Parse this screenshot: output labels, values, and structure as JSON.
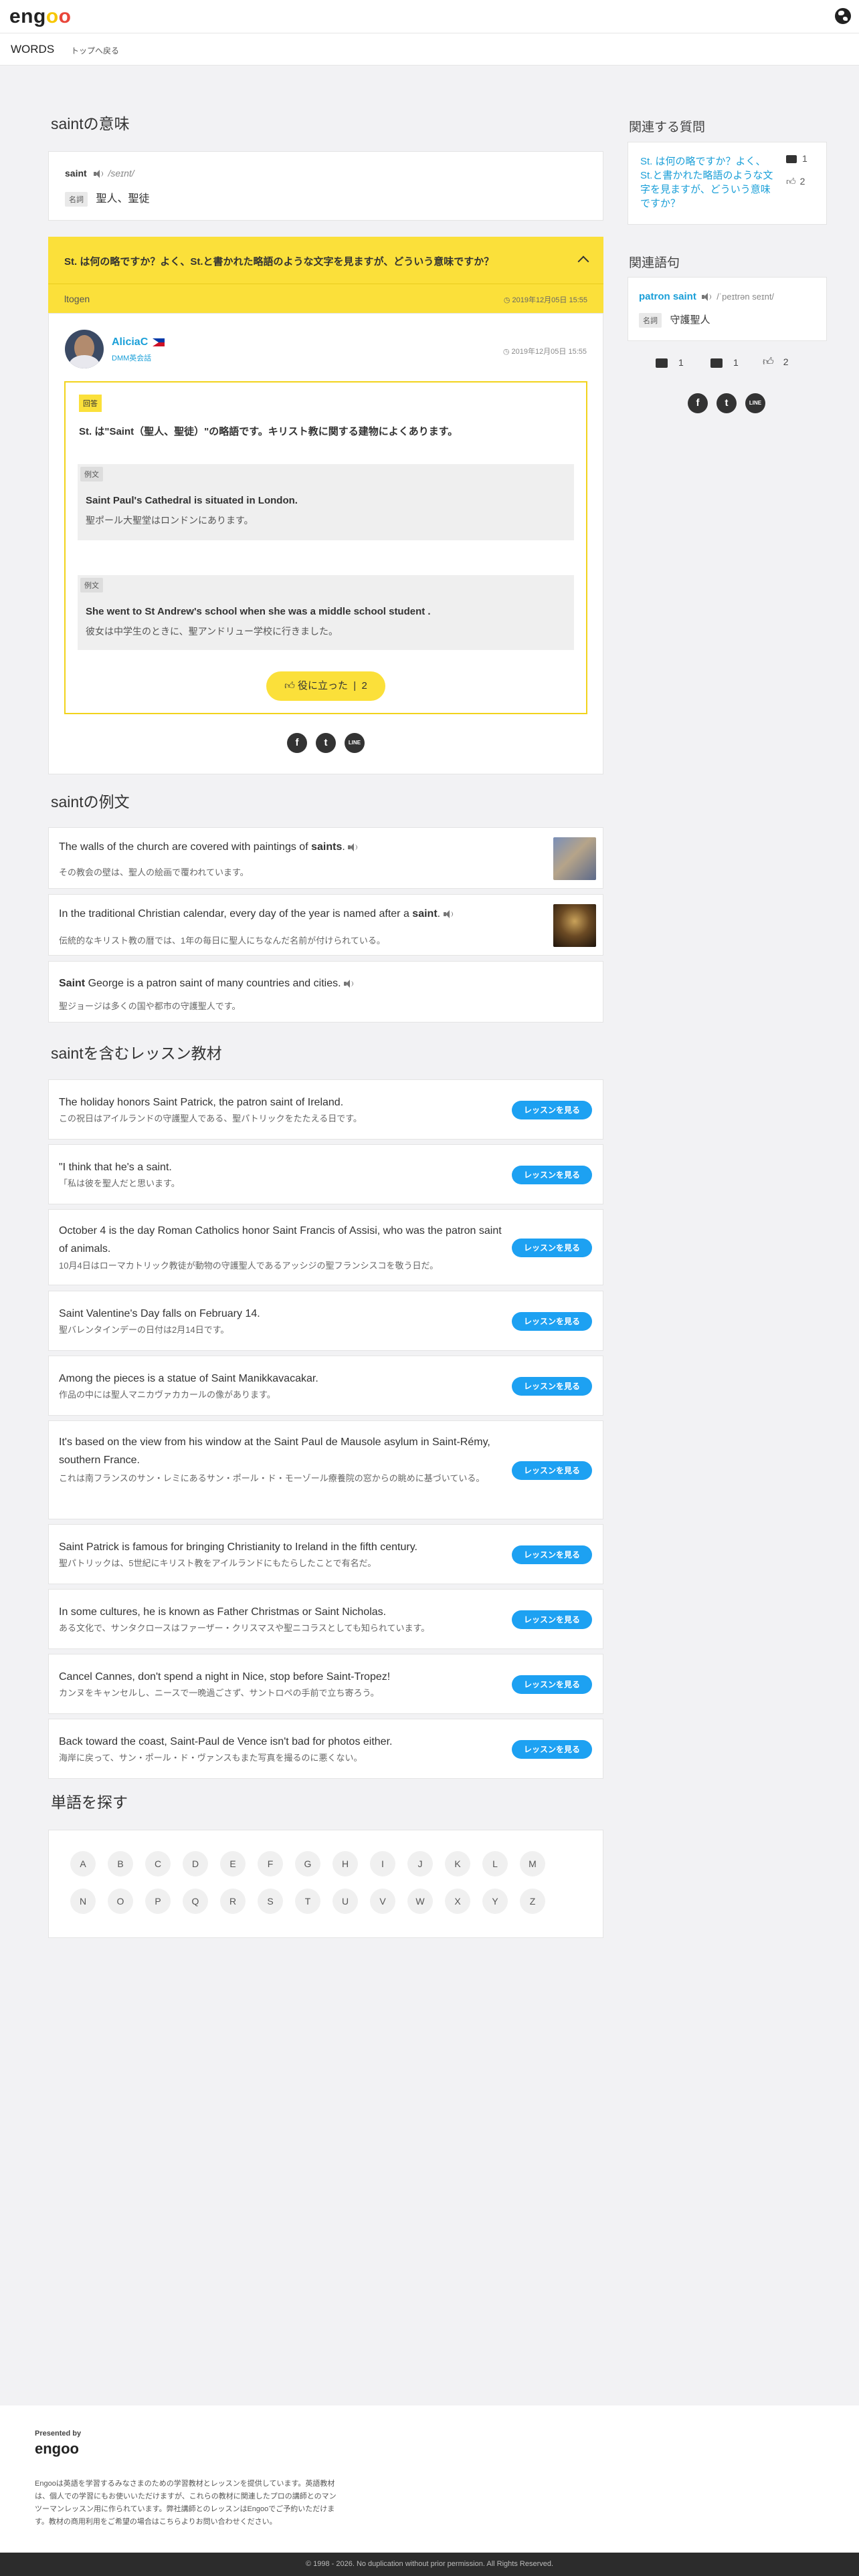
{
  "header": {
    "logo_prefix": "eng",
    "logo_o1": "o",
    "logo_o2": "o",
    "globe_icon": "globe-icon"
  },
  "subnav": {
    "words": "WORDS",
    "back_link": "トップへ戻る"
  },
  "meaning": {
    "title": "saintの意味",
    "word": "saint",
    "pronunciation": "/seɪnt/",
    "pos": "名詞",
    "definition": "聖人、聖徒"
  },
  "qa": {
    "question": "St. は何の略ですか？よく、St.と書かれた略語のような文字を見ますが、どういう意味ですか？",
    "asker": "ltogen",
    "asked_date": "2019年12月05日 15:55",
    "answerer": "AliciaC",
    "answerer_badge": "DMM英会話",
    "answered_date": "2019年12月05日 15:55",
    "answer_label": "回答",
    "answer_text": "St. は\"Saint（聖人、聖徒）\"の略語です。キリスト教に関する建物によくあります。",
    "example_label": "例文",
    "examples": [
      {
        "en": "Saint Paul's Cathedral is situated in London.",
        "ja": "聖ポール大聖堂はロンドンにあります。"
      },
      {
        "en": "She went to St Andrew's school when she was a middle school student .",
        "ja": "彼女は中学生のときに、聖アンドリュー学校に行きました。"
      }
    ],
    "helpful_label": "役に立った",
    "helpful_count": "2"
  },
  "sentences": {
    "title": "saintの例文",
    "items": [
      {
        "before": "The walls of the church are covered with paintings of ",
        "bold": "saints",
        "after": ".",
        "ja": "その教会の壁は、聖人の絵画で覆われています。"
      },
      {
        "before": "In the traditional Christian calendar, every day of the year is named after a ",
        "bold": "saint",
        "after": ".",
        "ja": "伝統的なキリスト教の暦では、1年の毎日に聖人にちなんだ名前が付けられている。"
      },
      {
        "before": "",
        "bold": "Saint",
        "after": " George is a patron saint of many countries and cities.",
        "ja": "聖ジョージは多くの国や都市の守護聖人です。"
      }
    ]
  },
  "lessons": {
    "title": "saintを含むレッスン教材",
    "button_label": "レッスンを見る",
    "items": [
      {
        "en": "The holiday honors Saint Patrick, the patron saint of Ireland.",
        "ja": "この祝日はアイルランドの守護聖人である、聖パトリックをたたえる日です。"
      },
      {
        "en": "\"I think that he's a saint.",
        "ja": "「私は彼を聖人だと思います。"
      },
      {
        "en": "October 4 is the day Roman Catholics honor Saint Francis of Assisi, who was the patron saint of animals.",
        "ja": "10月4日はローマカトリック教徒が動物の守護聖人であるアッシジの聖フランシスコを敬う日だ。"
      },
      {
        "en": "Saint Valentine's Day falls on February 14.",
        "ja": "聖バレンタインデーの日付は2月14日です。"
      },
      {
        "en": "Among the pieces is a statue of Saint Manikkavacakar.",
        "ja": "作品の中には聖人マニカヴァカカールの像があります。"
      },
      {
        "en": "It's based on the view from his window at the Saint Paul de Mausole asylum in Saint-Rémy, southern France.",
        "ja": "これは南フランスのサン・レミにあるサン・ポール・ド・モーゾール療養院の窓からの眺めに基づいている。"
      },
      {
        "en": "Saint Patrick is famous for bringing Christianity to Ireland in the fifth century.",
        "ja": "聖パトリックは、5世紀にキリスト教をアイルランドにもたらしたことで有名だ。"
      },
      {
        "en": "In some cultures, he is known as Father Christmas or Saint Nicholas.",
        "ja": "ある文化で、サンタクロースはファーザー・クリスマスや聖ニコラスとしても知られています。"
      },
      {
        "en": "Cancel Cannes, don't spend a night in Nice, stop before Saint-Tropez!",
        "ja": "カンヌをキャンセルし、ニースで一晩過ごさず、サントロペの手前で立ち寄ろう。"
      },
      {
        "en": "Back toward the coast, Saint-Paul de Vence isn't bad for photos either.",
        "ja": "海岸に戻って、サン・ポール・ド・ヴァンスもまた写真を撮るのに悪くない。"
      }
    ]
  },
  "alphabet": {
    "title": "単語を探す",
    "row1": [
      "A",
      "B",
      "C",
      "D",
      "E",
      "F",
      "G",
      "H",
      "I",
      "J",
      "K",
      "L",
      "M"
    ],
    "row2": [
      "N",
      "O",
      "P",
      "Q",
      "R",
      "S",
      "T",
      "U",
      "V",
      "W",
      "X",
      "Y",
      "Z"
    ]
  },
  "sidebar": {
    "related_questions_title": "関連する質問",
    "question_link": "St. は何の略ですか？よく、St.と書かれた略語のような文字を見ますが、どういう意味ですか？",
    "question_answers": "1",
    "question_likes": "2",
    "related_words_title": "関連語句",
    "word": "patron saint",
    "word_pron": "/ˈpeɪtrən seɪnt/",
    "word_pos": "名詞",
    "word_def": "守護聖人",
    "stats": {
      "search": "1",
      "answers": "1",
      "likes": "2"
    }
  },
  "share": {
    "facebook": "f",
    "twitter": "t",
    "line": "LINE"
  },
  "footer": {
    "presented_by": "Presented by",
    "logo": "engoo",
    "text_1": "Engooは英語を学習するみなさまのための学習教材とレッスンを提供しています。英語教材",
    "text_2": "は、個人での学習にもお使いいただけますが、これらの教材に関連したプロの講師とのマン",
    "text_3": "ツーマンレッスン用に作られています。弊社講師とのレッスンはEngooでご予約いただけま",
    "text_4": "す。教材の商用利用をご希望の場合はこちらよりお問い合わせください。",
    "copyright": "© 1998 - 2026. No duplication without prior permission. All Rights Reserved."
  },
  "colors": {
    "accent_yellow": "#fbe03a",
    "link_blue": "#1a9fd8",
    "button_blue": "#1da1f2"
  }
}
